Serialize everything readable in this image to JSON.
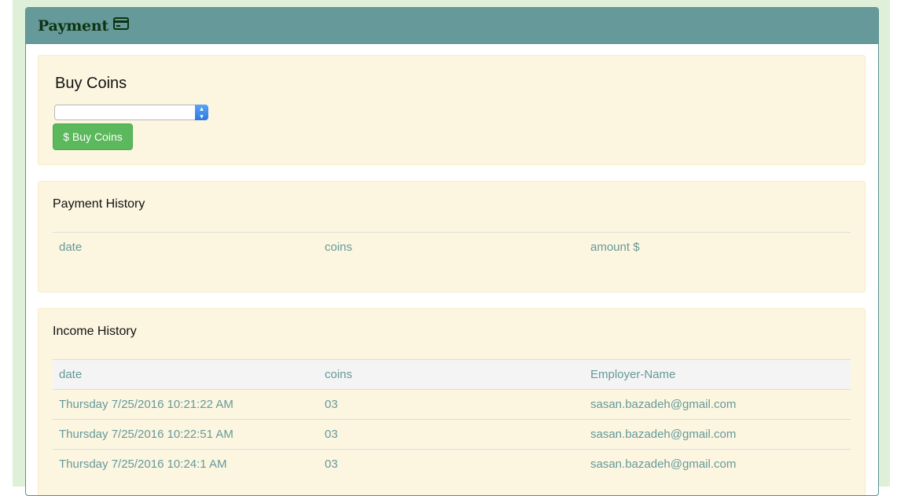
{
  "panel": {
    "title": "Payment",
    "icon": "credit-card-icon"
  },
  "buy": {
    "title": "Buy Coins",
    "select_value": "",
    "button_label": "$ Buy Coins",
    "button_color": "#5cb85c"
  },
  "payment_history": {
    "title": "Payment History",
    "columns": [
      "date",
      "coins",
      "amount $"
    ],
    "rows": []
  },
  "income_history": {
    "title": "Income History",
    "columns": [
      "date",
      "coins",
      "Employer-Name"
    ],
    "rows": [
      [
        "Thursday 7/25/2016 10:21:22 AM",
        "03",
        "sasan.bazadeh@gmail.com"
      ],
      [
        "Thursday 7/25/2016 10:22:51 AM",
        "03",
        "sasan.bazadeh@gmail.com"
      ],
      [
        "Thursday 7/25/2016 10:24:1 AM",
        "03",
        "sasan.bazadeh@gmail.com"
      ]
    ]
  },
  "colors": {
    "header_bg": "#669999",
    "well_bg": "#fcf6e1",
    "text_teal": "#669999"
  }
}
